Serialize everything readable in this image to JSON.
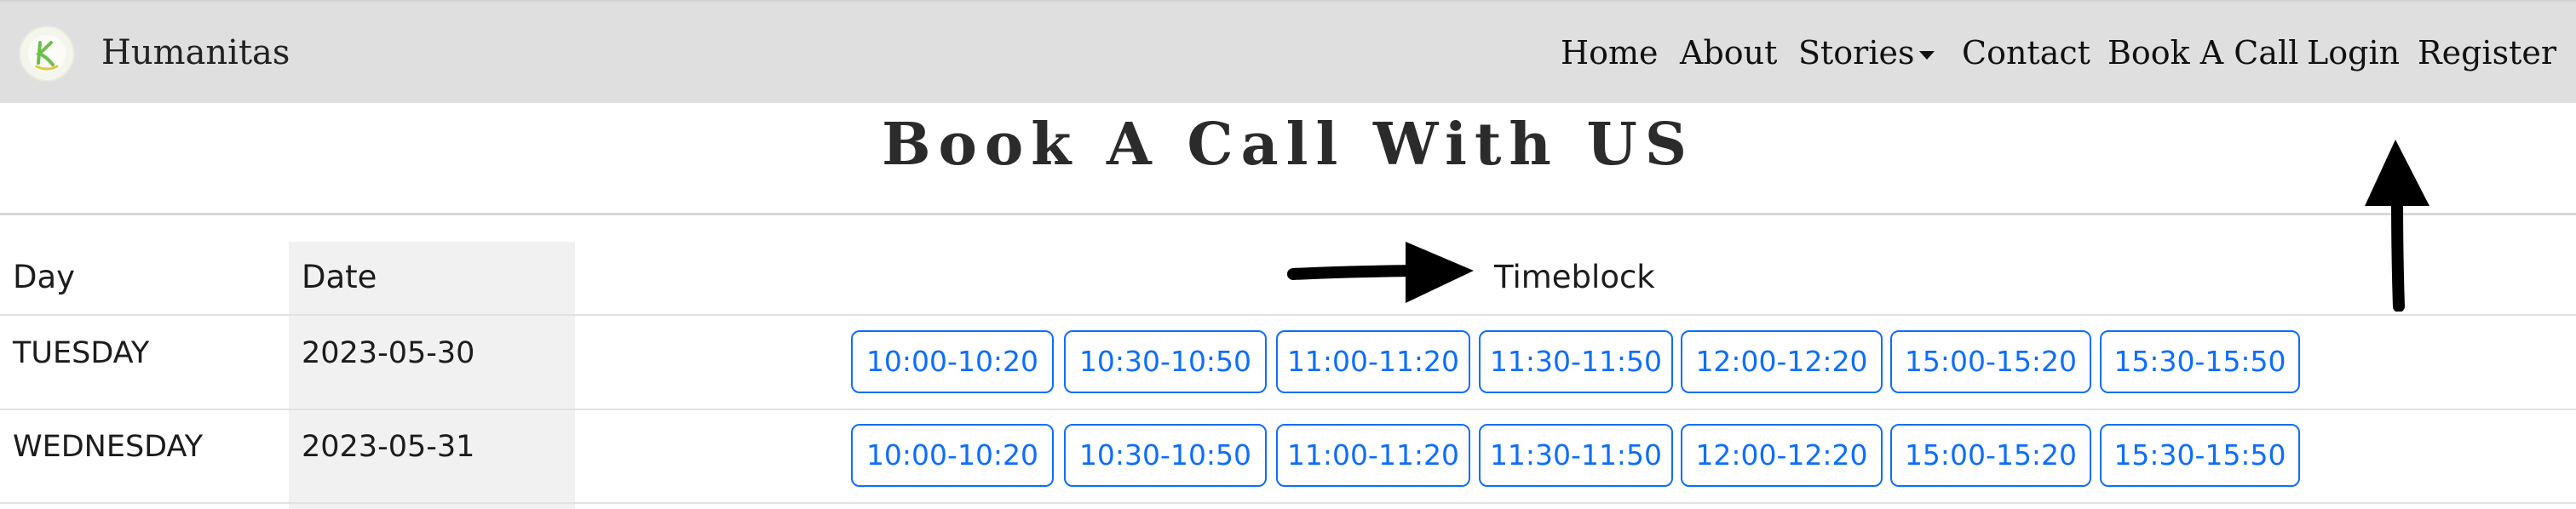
{
  "navbar": {
    "brand": "Humanitas",
    "brand_logo_letter": "K",
    "links": {
      "home": "Home",
      "about": "About",
      "stories": "Stories",
      "contact": "Contact",
      "book": "Book A Call",
      "login": "Login",
      "register": "Register"
    }
  },
  "page": {
    "title": "Book A Call With US"
  },
  "table": {
    "headers": {
      "day": "Day",
      "date": "Date",
      "timeblock": "Timeblock"
    },
    "rows": [
      {
        "day": "TUESDAY",
        "date": "2023-05-30",
        "slots": [
          "10:00-10:20",
          "10:30-10:50",
          "11:00-11:20",
          "11:30-11:50",
          "12:00-12:20",
          "15:00-15:20",
          "15:30-15:50"
        ]
      },
      {
        "day": "WEDNESDAY",
        "date": "2023-05-31",
        "slots": [
          "10:00-10:20",
          "10:30-10:50",
          "11:00-11:20",
          "11:30-11:50",
          "12:00-12:20",
          "15:00-15:20",
          "15:30-15:50"
        ]
      }
    ]
  },
  "colors": {
    "accent": "#0d6efd",
    "navbar_bg": "#dfdfdf",
    "logo_green": "#6cc04a"
  }
}
